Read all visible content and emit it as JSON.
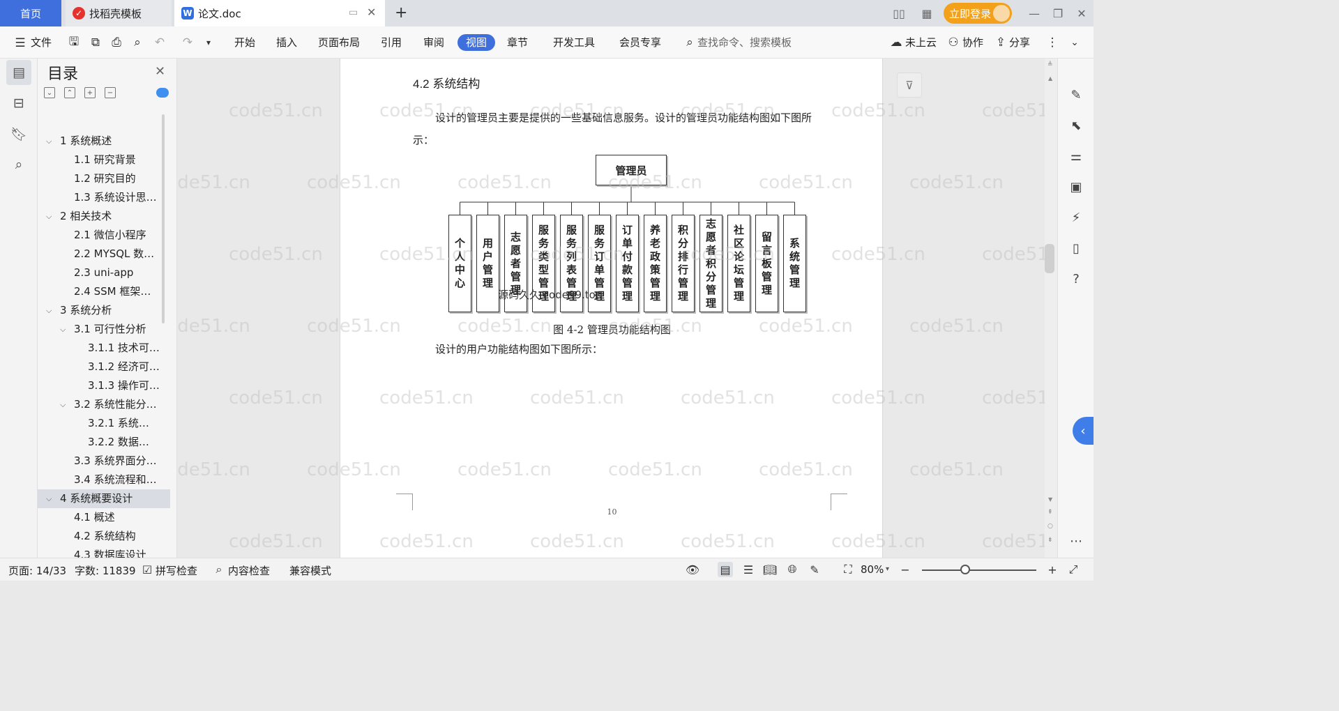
{
  "tabs": {
    "home": "首页",
    "find_template": "找稻壳模板",
    "doc": "论文.doc"
  },
  "titlebar": {
    "login_label": "立即登录"
  },
  "menu": {
    "file": "文件",
    "items": [
      "开始",
      "插入",
      "页面布局",
      "引用",
      "审阅",
      "视图",
      "章节",
      "开发工具",
      "会员专享"
    ],
    "active": "视图",
    "search_placeholder": "查找命令、搜索模板",
    "cloud": "未上云",
    "collab": "协作",
    "share": "分享"
  },
  "toc": {
    "title": "目录",
    "items": [
      {
        "label": "1 系统概述",
        "level": 1
      },
      {
        "label": "1.1  研究背景",
        "level": 2
      },
      {
        "label": "1.2 研究目的",
        "level": 2
      },
      {
        "label": "1.3 系统设计思…",
        "level": 2
      },
      {
        "label": "2 相关技术",
        "level": 1
      },
      {
        "label": "2.1 微信小程序",
        "level": 2
      },
      {
        "label": "2.2 MYSQL 数…",
        "level": 2
      },
      {
        "label": "2.3 uni-app",
        "level": 2
      },
      {
        "label": "2.4 SSM 框架…",
        "level": 2
      },
      {
        "label": "3 系统分析",
        "level": 1
      },
      {
        "label": "3.1 可行性分析",
        "level": 2
      },
      {
        "label": "3.1.1 技术可…",
        "level": 3
      },
      {
        "label": "3.1.2 经济可…",
        "level": 3
      },
      {
        "label": "3.1.3 操作可…",
        "level": 3
      },
      {
        "label": "3.2 系统性能分…",
        "level": 2
      },
      {
        "label": "3.2.1  系统…",
        "level": 3
      },
      {
        "label": "3.2.2  数据…",
        "level": 3
      },
      {
        "label": "3.3 系统界面分…",
        "level": 2
      },
      {
        "label": "3.4 系统流程和…",
        "level": 2
      },
      {
        "label": "4 系统概要设计",
        "level": 1
      },
      {
        "label": "4.1 概述",
        "level": 2
      },
      {
        "label": "4.2 系统结构",
        "level": 2
      },
      {
        "label": "4.3 数据库设计",
        "level": 2
      }
    ],
    "selected_index": 19
  },
  "document": {
    "heading": "4.2 系统结构",
    "para1_line1": "设计的管理员主要是提供的一些基础信息服务。设计的管理员功能结构图如下图所",
    "para1_line2": "示：",
    "figure_caption": "图 4-2 管理员功能结构图",
    "para2": "设计的用户功能结构图如下图所示：",
    "page_number": "10",
    "diagram": {
      "root": "管理员",
      "children": [
        "个人中心",
        "用户管理",
        "志愿者管理",
        "服务类型管理",
        "服务列表管理",
        "服务订单管理",
        "订单付款管理",
        "养老政策管理",
        "积分排行管理",
        "志愿者积分管理",
        "社区论坛管理",
        "留言板管理",
        "系统管理"
      ],
      "overlay_text": "源码久久 code99.top"
    },
    "watermark": "code51.cn"
  },
  "status": {
    "page": "页面: 14/33",
    "words": "字数: 11839",
    "spell": "拼写检查",
    "content_check": "内容检查",
    "compat": "兼容模式",
    "zoom": "80%",
    "zoom_fraction": 0.38
  }
}
